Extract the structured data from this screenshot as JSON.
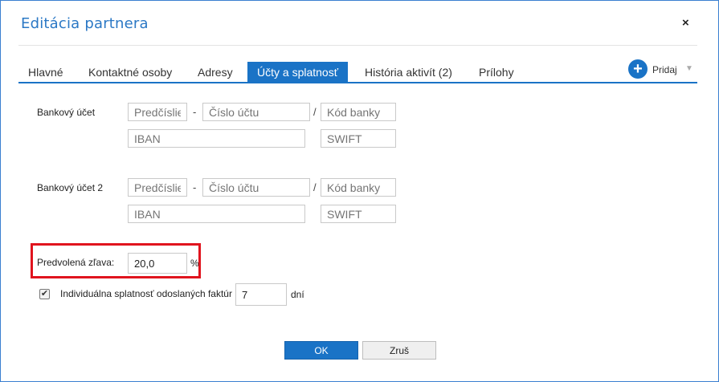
{
  "dialog": {
    "title": "Editácia partnera",
    "close_label": "×"
  },
  "tabs": [
    {
      "label": "Hlavné",
      "active": false
    },
    {
      "label": "Kontaktné osoby",
      "active": false
    },
    {
      "label": "Adresy",
      "active": false
    },
    {
      "label": "Účty a splatnosť",
      "active": true
    },
    {
      "label": "História aktivít (2)",
      "active": false
    },
    {
      "label": "Prílohy",
      "active": false
    }
  ],
  "add": {
    "icon": "plus-circle-icon",
    "label": "Pridaj",
    "caret": "▼"
  },
  "bank1": {
    "label": "Bankový účet",
    "prefix_placeholder": "Predčíslie",
    "account_placeholder": "Číslo účtu",
    "bank_code_placeholder": "Kód banky",
    "iban_placeholder": "IBAN",
    "swift_placeholder": "SWIFT",
    "dash": "-",
    "slash": "/"
  },
  "bank2": {
    "label": "Bankový účet 2",
    "prefix_placeholder": "Predčíslie",
    "account_placeholder": "Číslo účtu",
    "bank_code_placeholder": "Kód banky",
    "iban_placeholder": "IBAN",
    "swift_placeholder": "SWIFT",
    "dash": "-",
    "slash": "/"
  },
  "discount": {
    "label": "Predvolená zľava:",
    "value": "20,0",
    "unit": "%"
  },
  "due": {
    "checked": true,
    "check_mark": "✔",
    "label": "Individuálna splatnosť odoslaných faktúr",
    "value": "7",
    "unit": "dní"
  },
  "buttons": {
    "ok": "OK",
    "cancel": "Zruš"
  },
  "colors": {
    "accent": "#1a73c6",
    "highlight": "#e0141e",
    "title": "#2b78c5"
  }
}
